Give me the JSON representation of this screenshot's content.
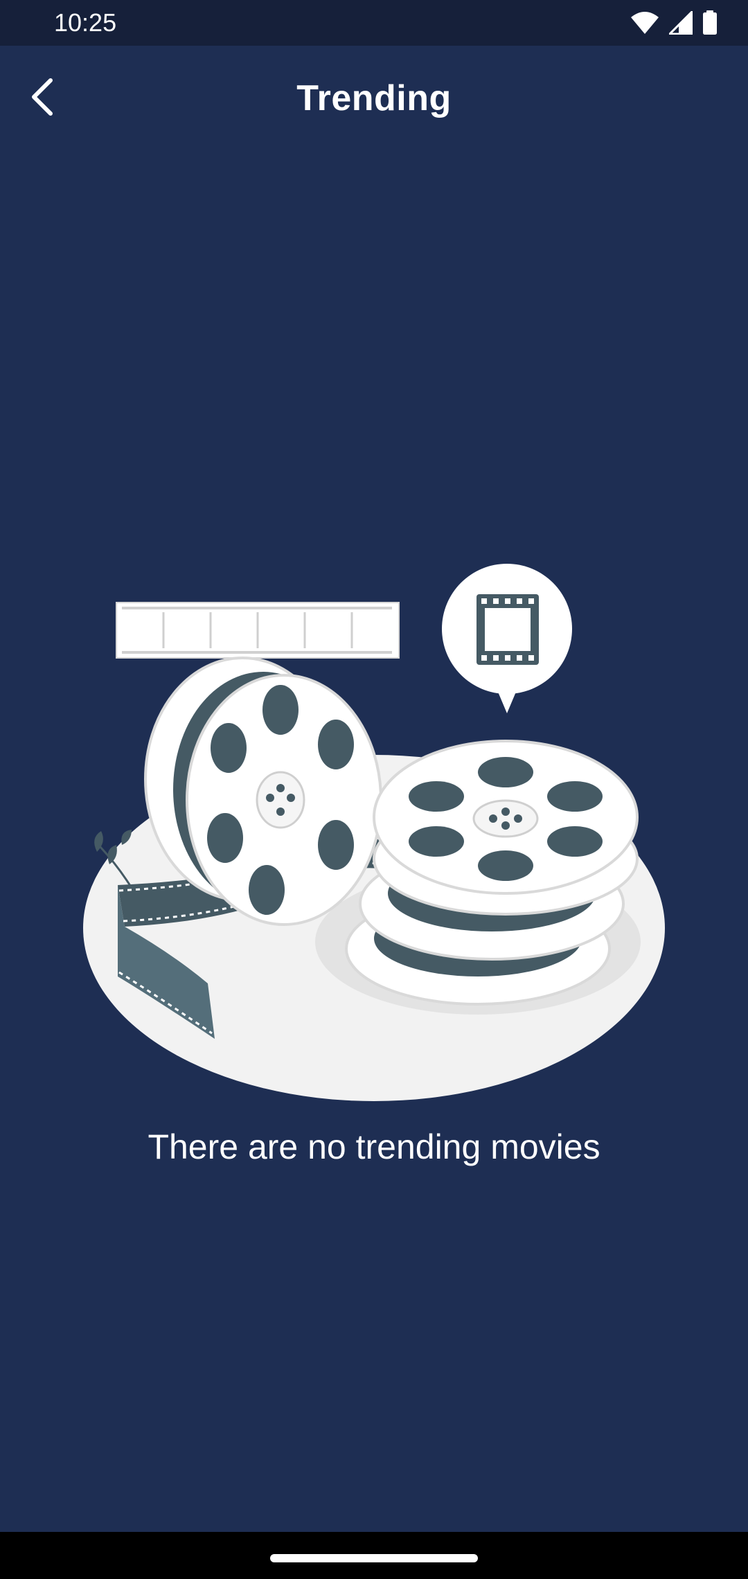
{
  "status_bar": {
    "time": "10:25",
    "icons": [
      "wifi-icon",
      "cell-signal-icon",
      "battery-icon"
    ]
  },
  "app_bar": {
    "back_icon": "back-arrow-icon",
    "title": "Trending"
  },
  "empty_state": {
    "illustration": "film-reels-illustration",
    "message": "There are no trending movies"
  },
  "colors": {
    "background": "#1e2e53",
    "status_bar": "#16203a",
    "nav_bar": "#000000",
    "illustration_light": "#f2f2f2",
    "illustration_dark": "#455a64"
  }
}
